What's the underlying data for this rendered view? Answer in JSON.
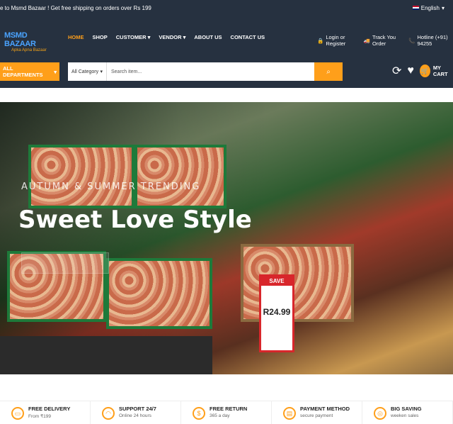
{
  "topbar": {
    "announcement": "e to Msmd Bazaar ! Get free shipping on orders over Rs 199",
    "language": "English"
  },
  "logo": {
    "name": "MSMD BAZAAR",
    "tagline": "Apka Apna Bazaar"
  },
  "nav": {
    "items": [
      "HOME",
      "SHOP",
      "CUSTOMER",
      "VENDOR",
      "ABOUT US",
      "CONTACT US"
    ]
  },
  "header_right": {
    "login": "Login or Register",
    "track": "Track You Order",
    "hotline": "Hotline (+91) 94255"
  },
  "search": {
    "departments": "ALL DEPARTMENTS",
    "category": "All Category",
    "placeholder": "Search item..."
  },
  "cart": {
    "label": "MY CART",
    "count": "0"
  },
  "hero": {
    "subtitle": "AUTUMN & SUMMER TRENDING",
    "title": "Sweet Love Style",
    "sign_label": "SAVE",
    "sign_price": "R24.99"
  },
  "features": [
    {
      "title": "FREE DELIVERY",
      "sub": "From ₹199",
      "icon": "truck-icon"
    },
    {
      "title": "SUPPORT 24/7",
      "sub": "Online 24 hours",
      "icon": "headset-icon"
    },
    {
      "title": "FREE RETURN",
      "sub": "365 a day",
      "icon": "return-icon"
    },
    {
      "title": "PAYMENT METHOD",
      "sub": "secure payment",
      "icon": "card-icon"
    },
    {
      "title": "BIG SAVING",
      "sub": "weeken sales",
      "icon": "coins-icon"
    }
  ]
}
